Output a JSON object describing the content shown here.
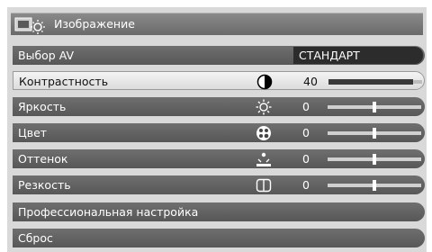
{
  "menu": {
    "title": "Изображение",
    "header_icon": "picture-settings-icon",
    "items": [
      {
        "label": "Выбор AV",
        "value": "СТАНДАРТ"
      },
      {
        "label": "Контрастность",
        "value": "40",
        "icon": "contrast-icon",
        "level": 0.9,
        "selected": true
      },
      {
        "label": "Яркость",
        "value": "0",
        "icon": "brightness-sun-icon",
        "level": 0.5
      },
      {
        "label": "Цвет",
        "value": "0",
        "icon": "color-palette-icon",
        "level": 0.5
      },
      {
        "label": "Оттенок",
        "value": "0",
        "icon": "tint-icon",
        "level": 0.5
      },
      {
        "label": "Резкость",
        "value": "0",
        "icon": "sharpness-icon",
        "level": 0.5
      },
      {
        "label": "Профессиональная настройка"
      },
      {
        "label": "Сброс"
      }
    ]
  }
}
